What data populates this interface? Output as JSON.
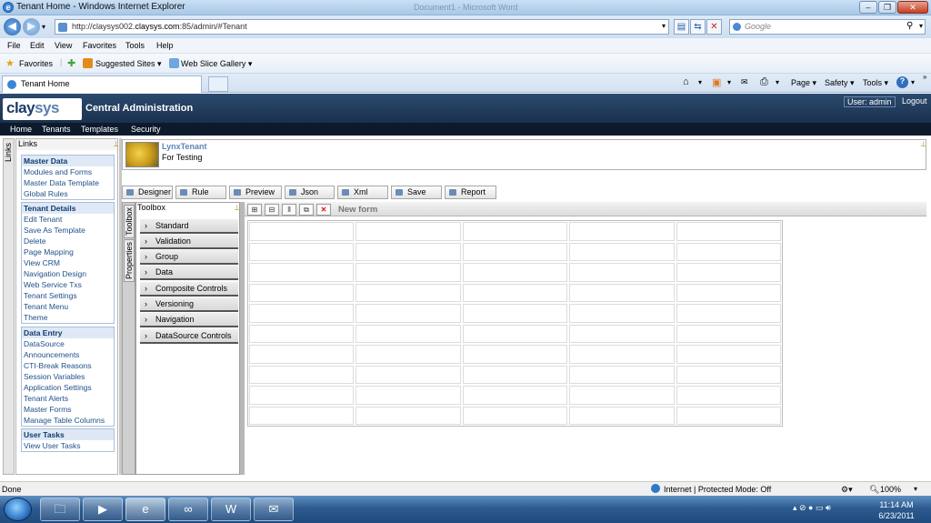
{
  "browser": {
    "window_title": "Tenant Home - Windows Internet Explorer",
    "ghost_title": "Document1 - Microsoft Word",
    "url_prefix": "http://claysys002.",
    "url_host": "claysys.com",
    "url_suffix": ":85/admin/#Tenant",
    "search_placeholder": "Google",
    "menu": [
      "File",
      "Edit",
      "View",
      "Favorites",
      "Tools",
      "Help"
    ],
    "favorites_label": "Favorites",
    "suggested_sites": "Suggested Sites ▾",
    "web_slice": "Web Slice Gallery ▾",
    "tab_title": "Tenant Home",
    "commands": [
      "Page ▾",
      "Safety ▾",
      "Tools ▾"
    ],
    "status_left": "Done",
    "status_zone": "Internet | Protected Mode: Off",
    "zoom": "100%"
  },
  "app": {
    "logo_main": "clay",
    "logo_accent": "sys",
    "title": "Central Administration",
    "user_label": "User: admin",
    "logout": "Logout",
    "nav": [
      "Home",
      "Tenants",
      "Templates",
      "Security"
    ]
  },
  "links": {
    "tab_label": "Links",
    "header": "Links",
    "groups": [
      {
        "title": "Master Data",
        "items": [
          "Modules and Forms",
          "Master Data Template",
          "Global Rules"
        ]
      },
      {
        "title": "Tenant Details",
        "items": [
          "Edit Tenant",
          "Save As Template",
          "Delete",
          "Page Mapping",
          "View CRM",
          "Navigation Design",
          "Web Service Txs",
          "Tenant Settings",
          "Tenant Menu",
          "Theme"
        ]
      },
      {
        "title": "Data Entry",
        "items": [
          "DataSource",
          "Announcements",
          "CTI-Break Reasons",
          "Session Variables",
          "Application Settings",
          "Tenant Alerts",
          "Master Forms",
          "Manage Table Columns"
        ]
      },
      {
        "title": "User Tasks",
        "items": [
          "View User Tasks"
        ]
      }
    ]
  },
  "tenant": {
    "name": "LynxTenant",
    "description": "For Testing"
  },
  "actions": [
    "Designer",
    "Rule",
    "Preview",
    "Json",
    "Xml",
    "Save",
    "Report"
  ],
  "side_tabs": [
    "Toolbox",
    "Properties"
  ],
  "toolbox": {
    "header": "Toolbox",
    "items": [
      "Standard",
      "Validation",
      "Group",
      "Data",
      "Composite Controls",
      "Versioning",
      "Navigation",
      "DataSource Controls"
    ]
  },
  "form": {
    "title": "New form"
  },
  "taskbar": {
    "time": "11:14 AM",
    "date": "6/23/2011"
  },
  "colors": {
    "header_bg": "#1a314f",
    "nav_bg": "#0d1a2b",
    "link_color": "#1f4f8a",
    "tenant_name": "#5a86b8"
  }
}
